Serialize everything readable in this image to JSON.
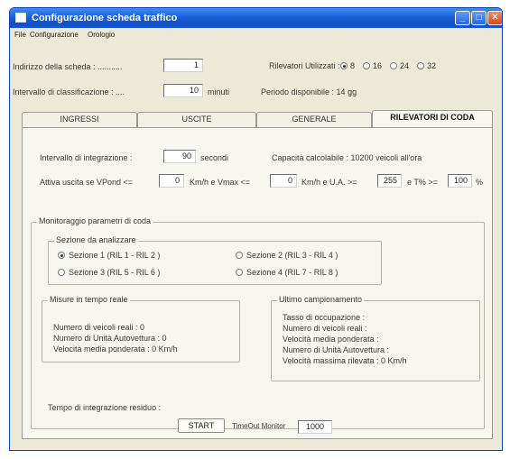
{
  "window": {
    "title": "Configurazione scheda traffico",
    "controls": {
      "minimize": "_",
      "maximize": "□",
      "close": "✕"
    }
  },
  "menu": [
    "File",
    "Configurazione",
    "Orologio"
  ],
  "header": {
    "address_label": "Indirizzo della scheda : ...........",
    "address_value": "1",
    "detectors_label": "Rilevatori Utilizzati :",
    "detector_options": [
      "8",
      "16",
      "24",
      "32"
    ],
    "detector_selected": "8",
    "interval_label": "Intervallo di classificazione : ....",
    "interval_value": "10",
    "interval_unit": "minuti",
    "period_label": "Periodo disponibile : 14 gg"
  },
  "tabs": [
    "INGRESSI",
    "USCITE",
    "GENERALE",
    "RILEVATORI DI CODA"
  ],
  "active_tab": "RILEVATORI DI CODA",
  "coda": {
    "integration_label": "Intervallo di integrazione :",
    "integration_value": "90",
    "integration_unit": "secondi",
    "capacity_label": "Capacità calcolabile : 10200 veicoli all'ora",
    "activate_label": "Attiva uscita se VPond <=",
    "vpond_value": "0",
    "vmax_label": "Km/h e Vmax <=",
    "vmax_value": "0",
    "ua_label": "Km/h e U.A. >=",
    "ua_value": "255",
    "t_label": "e T% >=",
    "t_value": "100",
    "t_unit": "%"
  },
  "monitor": {
    "legend": "Monitoraggio parametri di coda",
    "sections_legend": "Sezione da analizzare",
    "sections": [
      "Sezione 1 (RIL 1 - RIL 2 )",
      "Sezione 2 (RIL 3 - RIL 4 )",
      "Sezione 3 (RIL 5 - RIL 6 )",
      "Sezione 4 (RIL 7 - RIL 8 )"
    ],
    "selected_section": 0,
    "realtime_legend": "Misure in tempo reale",
    "realtime": [
      "Numero di veicoli reali : 0",
      "Numero di Unità Autovettura : 0",
      "Velocità media ponderata : 0 Km/h"
    ],
    "last_legend": "Ultimo campionamento",
    "last": [
      "Tasso di occupazione :",
      "Numero di veicoli reali :",
      "Velocità media ponderata :",
      "Numero di Unità Autovettura :",
      "Velocità massima rilevata : 0 Km/h"
    ],
    "residual_label": "Tempo di integrazione residuo :",
    "start_label": "START",
    "timeout_label": "TimeOut Monitor",
    "timeout_value": "1000"
  }
}
